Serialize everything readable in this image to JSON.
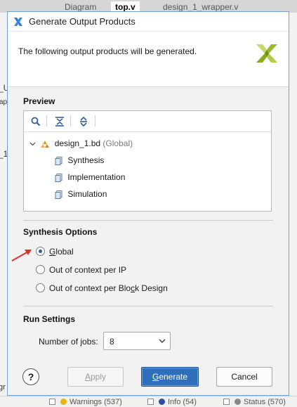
{
  "background": {
    "tabs": [
      "Diagram",
      "top.v",
      "design_1_wrapper.v"
    ],
    "left_fragments": [
      "_U",
      "ap",
      "_1",
      "gr"
    ],
    "bottom_items": [
      "Warnings (537)",
      "Info (54)",
      "Status (570)"
    ]
  },
  "dialog": {
    "title": "Generate Output Products",
    "description": "The following output products will be generated.",
    "preview": {
      "section_title": "Preview",
      "root": {
        "name": "design_1.bd",
        "scope": "(Global)"
      },
      "children": [
        "Synthesis",
        "Implementation",
        "Simulation"
      ]
    },
    "synthesis_options": {
      "section_title": "Synthesis Options",
      "options": [
        {
          "label": "Global",
          "selected": true
        },
        {
          "label": "Out of context per IP",
          "selected": false
        },
        {
          "label": "Out of context per Block Design",
          "selected": false
        }
      ]
    },
    "run_settings": {
      "section_title": "Run Settings",
      "jobs_label": "Number of jobs:",
      "jobs_value": "8"
    },
    "buttons": {
      "help": "?",
      "apply": "Apply",
      "generate": "Generate",
      "cancel": "Cancel"
    }
  },
  "colors": {
    "primary_button": "#2d6fba",
    "radio_selected": "#2a5ea8",
    "annotation_arrow": "#e0302a",
    "xilinx_logo": "#9ab82a"
  }
}
